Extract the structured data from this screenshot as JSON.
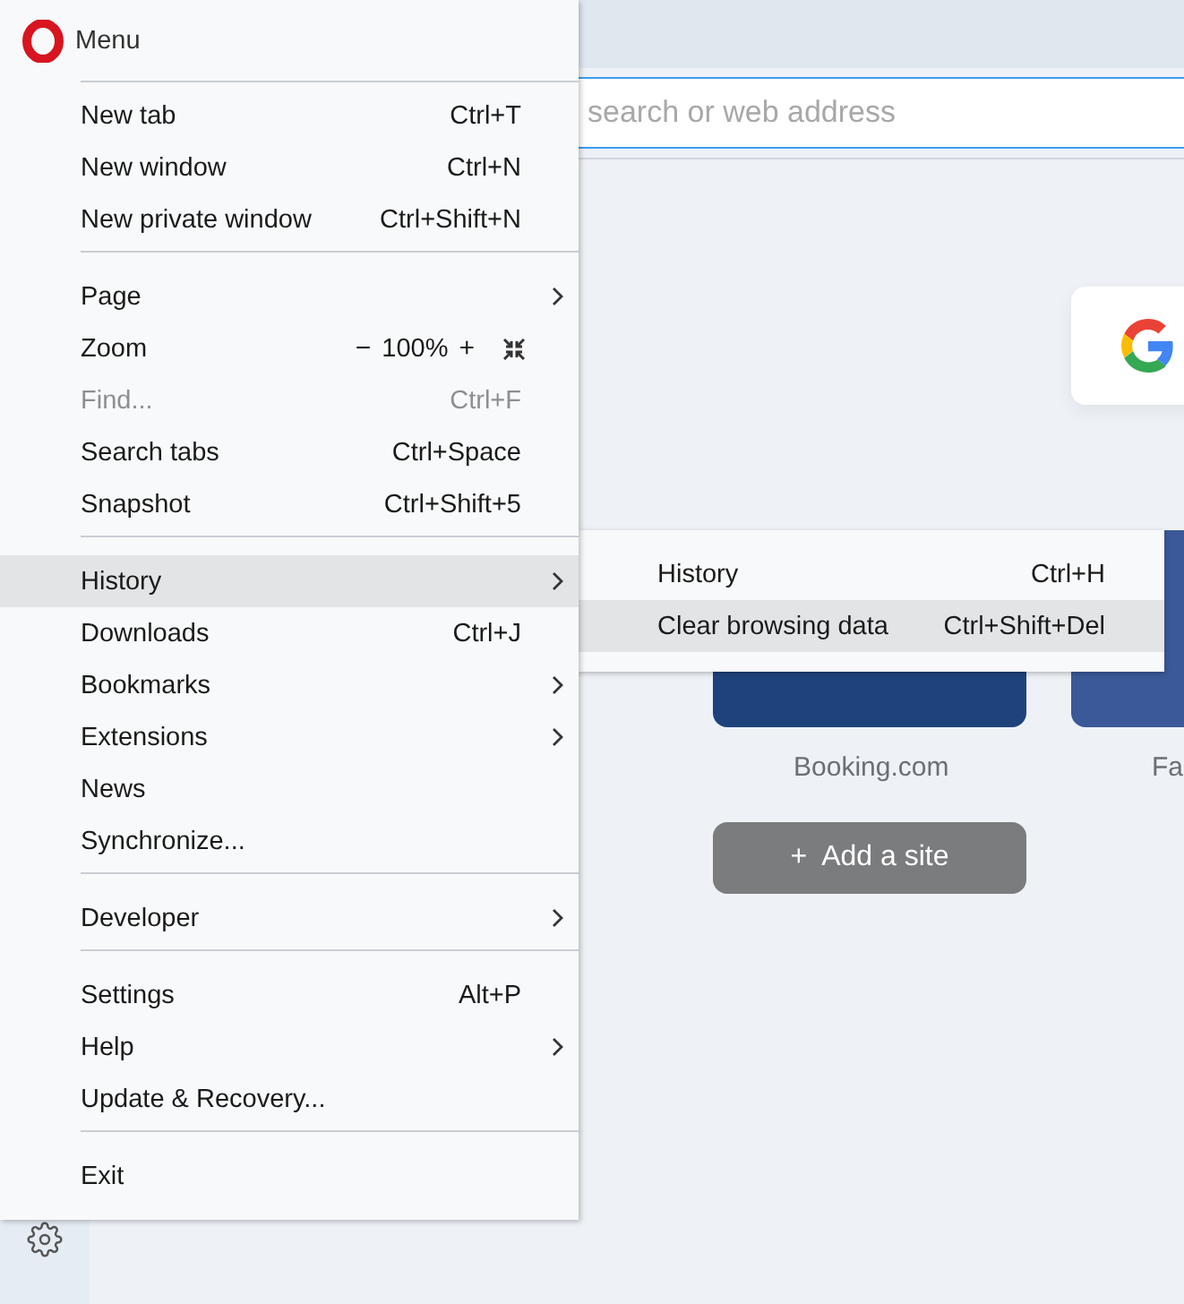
{
  "page": {
    "address_placeholder": "search or web address",
    "speed_dial": [
      {
        "label": "Booking.com",
        "color": "#1e437c"
      },
      {
        "label": "Fa",
        "color": "#3b5998"
      }
    ],
    "add_site": {
      "icon": "+",
      "label": "Add a site"
    }
  },
  "menu": {
    "title": "Menu",
    "sections": [
      [
        {
          "kind": "shortcut",
          "label": "New tab",
          "shortcut": "Ctrl+T",
          "disabled": false,
          "selected": false
        },
        {
          "kind": "shortcut",
          "label": "New window",
          "shortcut": "Ctrl+N",
          "disabled": false,
          "selected": false
        },
        {
          "kind": "shortcut",
          "label": "New private window",
          "shortcut": "Ctrl+Shift+N",
          "disabled": false,
          "selected": false
        }
      ],
      [
        {
          "kind": "submenu",
          "label": "Page",
          "disabled": false,
          "selected": false
        },
        {
          "kind": "zoom",
          "label": "Zoom",
          "zoom_out": "−",
          "zoom_value": "100%",
          "zoom_in": "+",
          "disabled": false,
          "selected": false
        },
        {
          "kind": "shortcut",
          "label": "Find...",
          "shortcut": "Ctrl+F",
          "disabled": true,
          "selected": false
        },
        {
          "kind": "shortcut",
          "label": "Search tabs",
          "shortcut": "Ctrl+Space",
          "disabled": false,
          "selected": false
        },
        {
          "kind": "shortcut",
          "label": "Snapshot",
          "shortcut": "Ctrl+Shift+5",
          "disabled": false,
          "selected": false
        }
      ],
      [
        {
          "kind": "submenu",
          "label": "History",
          "disabled": false,
          "selected": true
        },
        {
          "kind": "shortcut",
          "label": "Downloads",
          "shortcut": "Ctrl+J",
          "disabled": false,
          "selected": false
        },
        {
          "kind": "submenu",
          "label": "Bookmarks",
          "disabled": false,
          "selected": false
        },
        {
          "kind": "submenu",
          "label": "Extensions",
          "disabled": false,
          "selected": false
        },
        {
          "kind": "plain",
          "label": "News",
          "disabled": false,
          "selected": false
        },
        {
          "kind": "plain",
          "label": "Synchronize...",
          "disabled": false,
          "selected": false
        }
      ],
      [
        {
          "kind": "submenu",
          "label": "Developer",
          "disabled": false,
          "selected": false
        }
      ],
      [
        {
          "kind": "shortcut",
          "label": "Settings",
          "shortcut": "Alt+P",
          "disabled": false,
          "selected": false
        },
        {
          "kind": "submenu",
          "label": "Help",
          "disabled": false,
          "selected": false
        },
        {
          "kind": "plain",
          "label": "Update & Recovery...",
          "disabled": false,
          "selected": false
        }
      ],
      [
        {
          "kind": "plain",
          "label": "Exit",
          "disabled": false,
          "selected": false
        }
      ]
    ]
  },
  "submenu": {
    "items": [
      {
        "label": "History",
        "shortcut": "Ctrl+H",
        "selected": false
      },
      {
        "label": "Clear browsing data",
        "shortcut": "Ctrl+Shift+Del",
        "selected": true
      }
    ]
  }
}
